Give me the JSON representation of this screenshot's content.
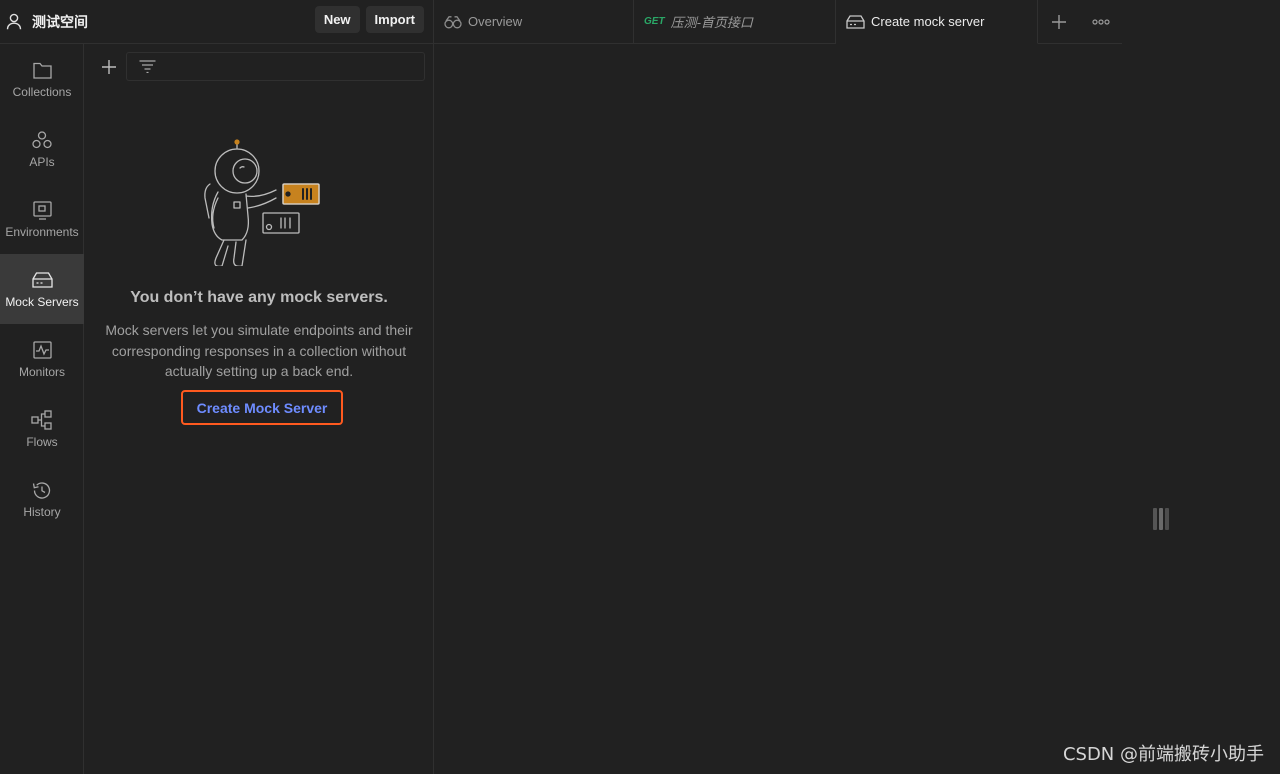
{
  "workspace": {
    "name": "测试空间",
    "new_label": "New",
    "import_label": "Import"
  },
  "tabs": [
    {
      "label": "Overview",
      "icon": "overview-icon"
    },
    {
      "method": "GET",
      "label": "压测-首页接口"
    },
    {
      "label": "Create mock server",
      "icon": "mock-server-icon",
      "active": true
    }
  ],
  "nav": {
    "items": [
      {
        "label": "Collections",
        "icon": "collections-icon"
      },
      {
        "label": "APIs",
        "icon": "apis-icon"
      },
      {
        "label": "Environments",
        "icon": "environments-icon"
      },
      {
        "label": "Mock Servers",
        "icon": "mock-servers-icon",
        "active": true
      },
      {
        "label": "Monitors",
        "icon": "monitors-icon"
      },
      {
        "label": "Flows",
        "icon": "flows-icon"
      },
      {
        "label": "History",
        "icon": "history-icon"
      }
    ]
  },
  "panel": {
    "empty_title": "You don’t have any mock servers.",
    "empty_description": "Mock servers let you simulate endpoints and their corresponding responses in a collection without actually setting up a back end.",
    "create_label": "Create Mock Server"
  },
  "watermark": "CSDN @前端搬砖小助手",
  "colors": {
    "background": "#212121",
    "active_nav": "#3a3a3a",
    "link": "#6e8cff",
    "highlight_border": "#ff5a1f",
    "get_method": "#2aa867",
    "illustration_accent": "#c7821e"
  }
}
